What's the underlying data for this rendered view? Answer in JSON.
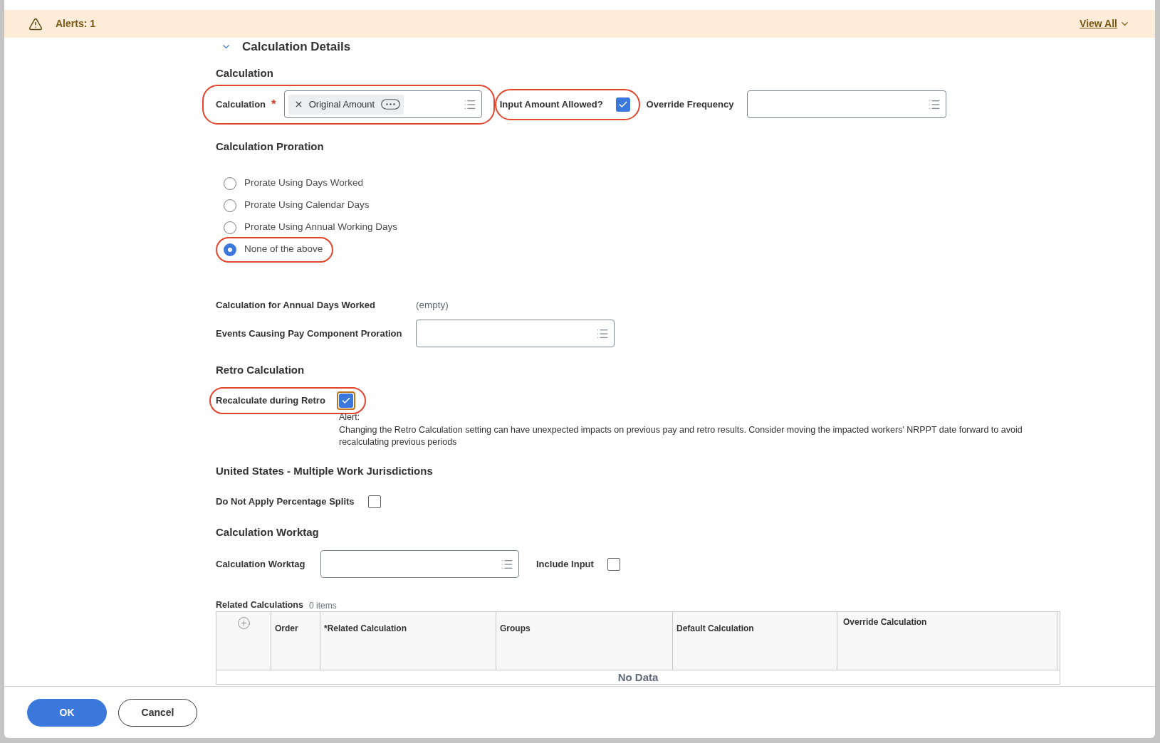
{
  "alert_bar": {
    "label": "Alerts: 1",
    "link": "View All"
  },
  "section": {
    "title": "Calculation Details",
    "expanded": true
  },
  "calculation": {
    "heading": "Calculation",
    "field": {
      "label": "Calculation",
      "required_mark": "*",
      "chip": "Original Amount",
      "highlighted": true
    },
    "input_amount_allowed": {
      "label": "Input Amount Allowed?",
      "checked": true,
      "highlighted": true
    },
    "override_frequency": {
      "label": "Override Frequency"
    }
  },
  "proration": {
    "heading": "Calculation Proration",
    "options": [
      {
        "label": "Prorate Using Days Worked",
        "selected": false,
        "highlighted": false
      },
      {
        "label": "Prorate Using Calendar Days",
        "selected": false,
        "highlighted": false
      },
      {
        "label": "Prorate Using Annual Working Days",
        "selected": false,
        "highlighted": false
      },
      {
        "label": "None of the above",
        "selected": true,
        "highlighted": true
      }
    ],
    "annual_days_worked": {
      "label": "Calculation for Annual Days Worked",
      "value": "(empty)"
    },
    "events": {
      "label": "Events Causing Pay Component Proration"
    }
  },
  "retro": {
    "heading": "Retro Calculation",
    "recalculate": {
      "label": "Recalculate during Retro",
      "checked": true,
      "focused": true,
      "highlighted": true
    },
    "alert": {
      "title": "Alert:",
      "message": "Changing the Retro Calculation setting can have unexpected impacts on previous pay and retro results. Consider moving the impacted workers' NRPPT date forward to avoid recalculating previous periods"
    }
  },
  "jurisdictions": {
    "heading": "United States - Multiple Work Jurisdictions",
    "percentage_splits": {
      "label": "Do Not Apply Percentage Splits",
      "checked": false
    }
  },
  "worktag": {
    "heading": "Calculation Worktag",
    "field": {
      "label": "Calculation Worktag"
    },
    "include_input": {
      "label": "Include Input",
      "checked": false
    }
  },
  "related_calculations": {
    "title": "Related Calculations",
    "count": "0 items",
    "columns": [
      "Order",
      "*Related Calculation",
      "Groups",
      "Default Calculation",
      "Override Calculation"
    ],
    "empty_text": "No Data"
  },
  "footer": {
    "buttons": [
      {
        "label": "OK",
        "kind": "primary"
      },
      {
        "label": "Cancel",
        "kind": "secondary"
      }
    ]
  }
}
